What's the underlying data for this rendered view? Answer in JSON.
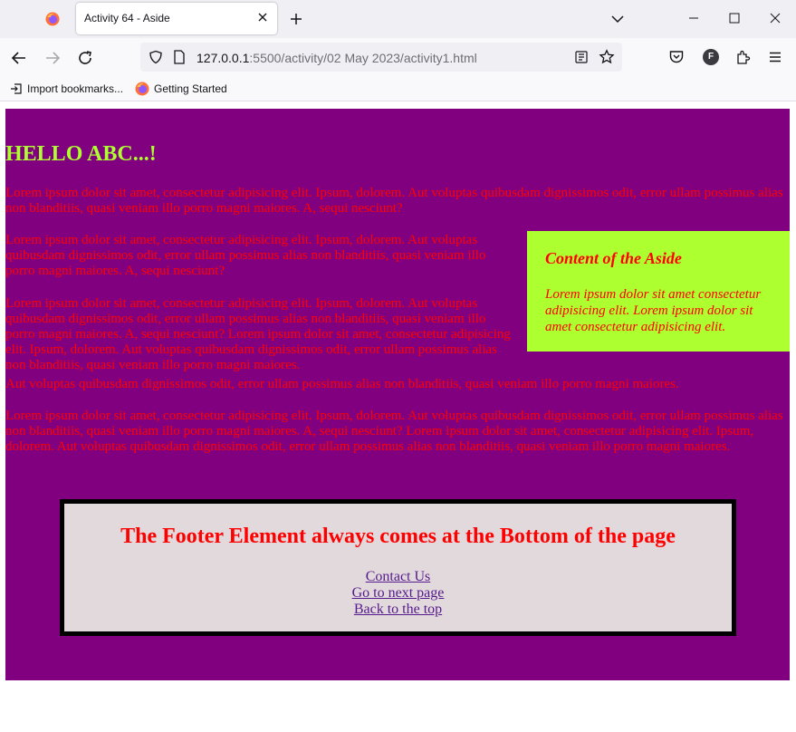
{
  "browser": {
    "tab_title": "Activity 64 - Aside",
    "url_host": "127.0.0.1",
    "url_rest": ":5500/activity/02 May 2023/activity1.html",
    "profile_initial": "F",
    "bookmarks": [
      "Import bookmarks...",
      "Getting Started"
    ]
  },
  "page": {
    "heading": "HELLO ABC...!",
    "paragraphs": [
      "Lorem ipsum dolor sit amet, consectetur adipisicing elit. Ipsum, dolorem. Aut voluptas quibusdam dignissimos odit, error ullam possimus alias non blanditiis, quasi veniam illo porro magni maiores. A, sequi nesciunt?",
      "Lorem ipsum dolor sit amet, consectetur adipisicing elit. Ipsum, dolorem. Aut voluptas quibusdam dignissimos odit, error ullam possimus alias non blanditiis, quasi veniam illo porro magni maiores. A, sequi nesciunt?",
      "Lorem ipsum dolor sit amet, consectetur adipisicing elit. Ipsum, dolorem. Aut voluptas quibusdam dignissimos odit, error ullam possimus alias non blanditiis, quasi veniam illo porro magni maiores. A, sequi nesciunt? Lorem ipsum dolor sit amet, consectetur adipisicing elit. Ipsum, dolorem. Aut voluptas quibusdam dignissimos odit, error ullam possimus alias non blanditiis, quasi veniam illo porro magni maiores.",
      "Aut voluptas quibusdam dignissimos odit, error ullam possimus alias non blanditiis, quasi veniam illo porro magni maiores.",
      "Lorem ipsum dolor sit amet, consectetur adipisicing elit. Ipsum, dolorem. Aut voluptas quibusdam dignissimos odit, error ullam possimus alias non blanditiis, quasi veniam illo porro magni maiores. A, sequi nesciunt? Lorem ipsum dolor sit amet, consectetur adipisicing elit. Ipsum, dolorem. Aut voluptas quibusdam dignissimos odit, error ullam possimus alias non blanditiis, quasi veniam illo porro magni maiores."
    ],
    "aside": {
      "title": "Content of the Aside",
      "text": "Lorem ipsum dolor sit amet consectetur adipisicing elit. Lorem ipsum dolor sit amet consectetur adipisicing elit."
    },
    "footer": {
      "title": "The Footer Element always comes at the Bottom of the page",
      "links": [
        "Contact Us",
        "Go to next page",
        "Back to the top"
      ]
    }
  },
  "colors": {
    "page_bg": "#800080",
    "heading": "#adff2f",
    "text": "#ff0000",
    "aside_bg": "#adff2f",
    "footer_bg": "#e2d9dc",
    "link": "#551a8b"
  }
}
